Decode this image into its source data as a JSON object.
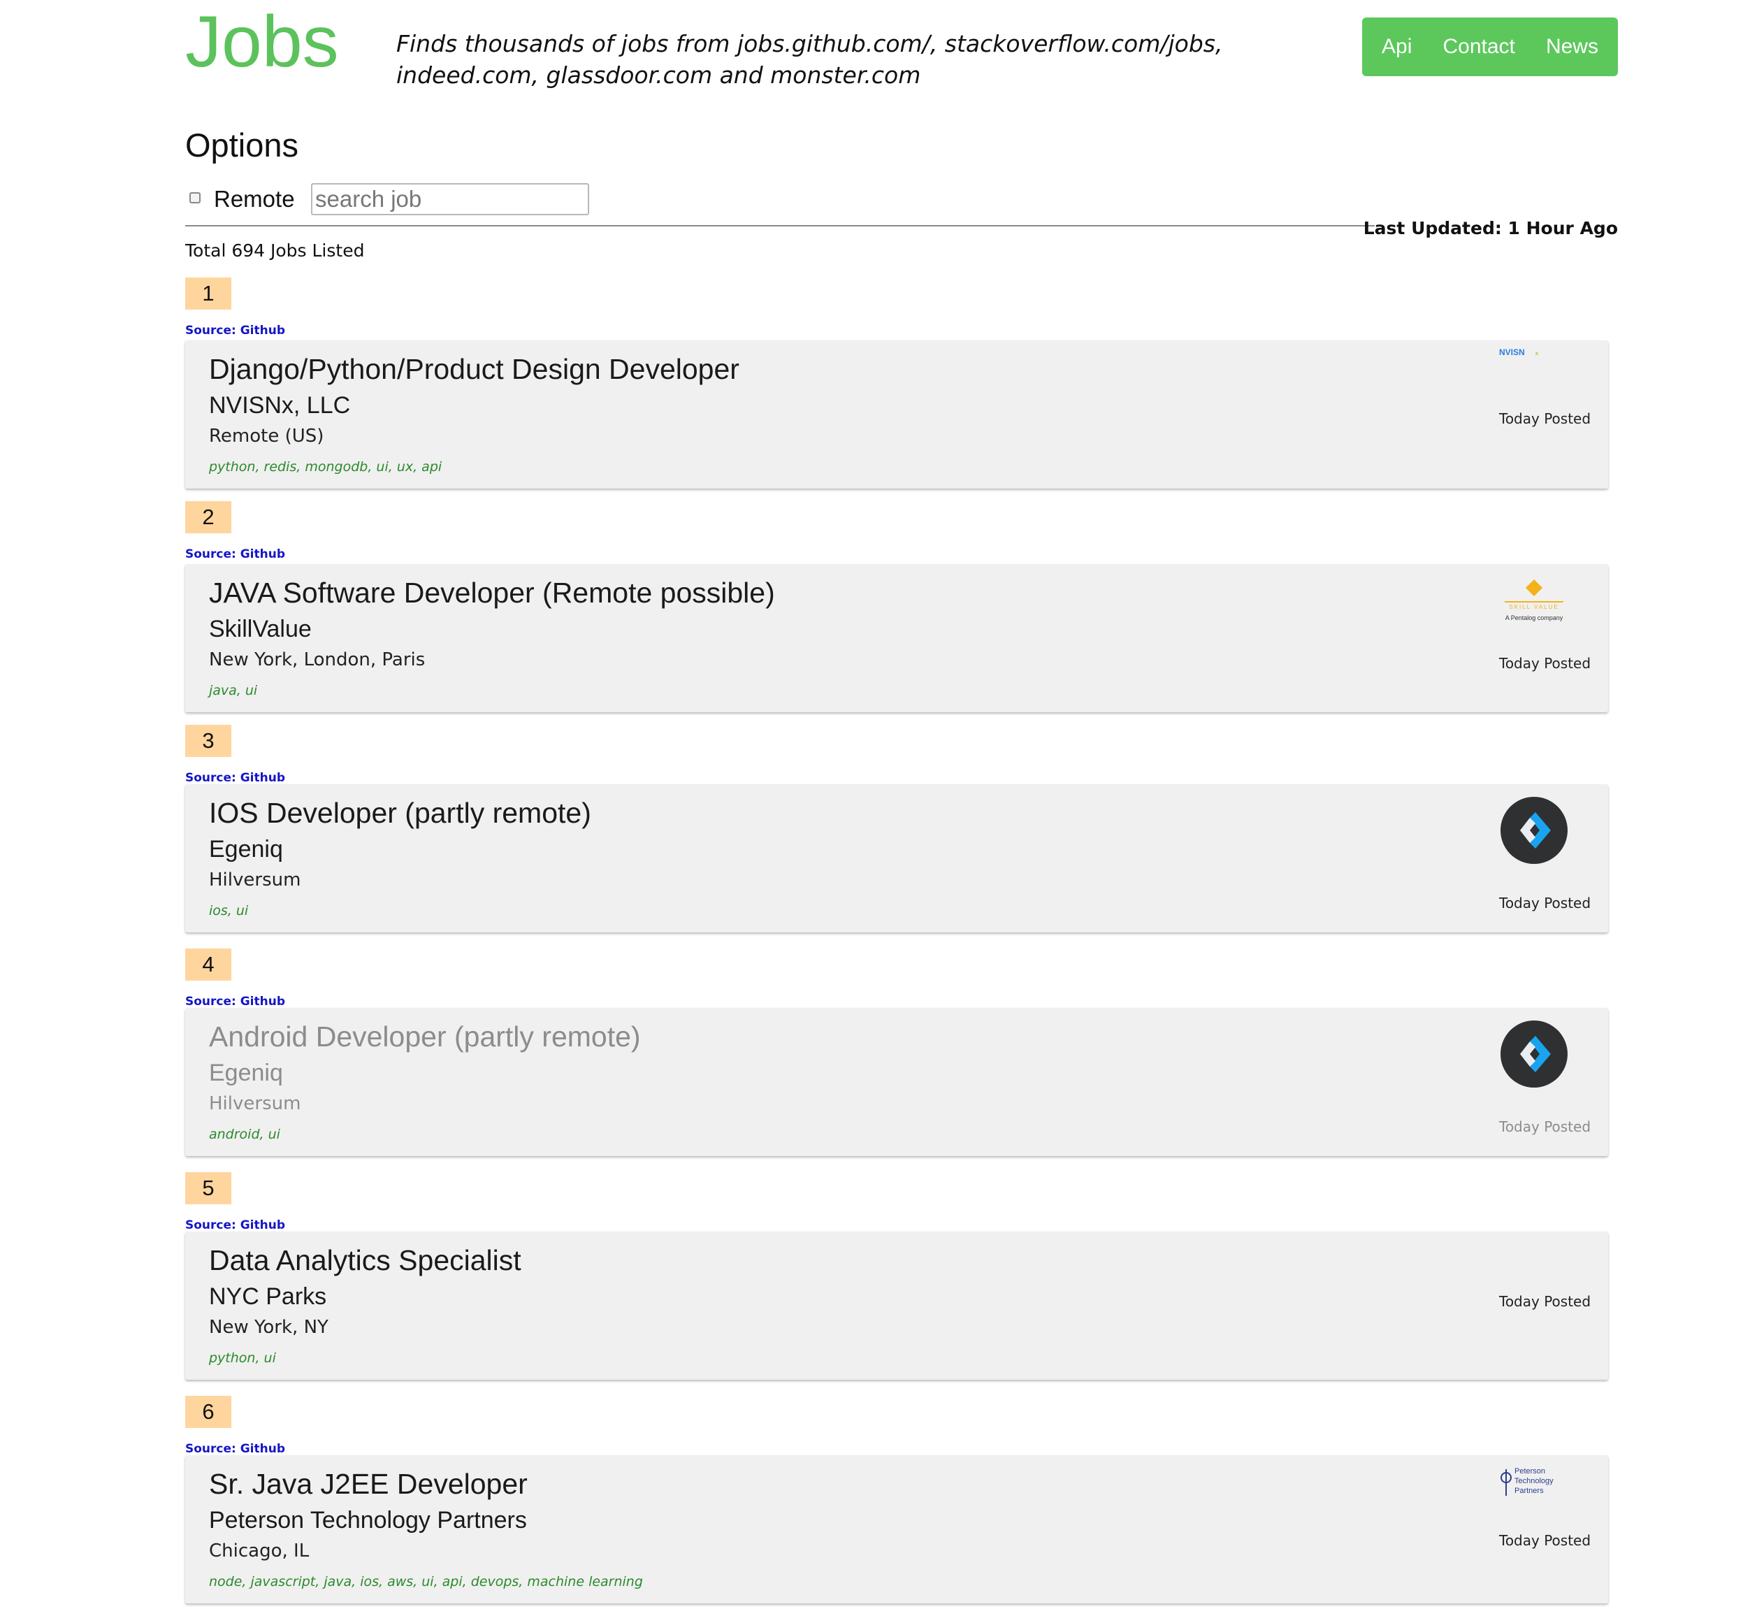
{
  "header": {
    "brand": "Jobs",
    "tagline": "Finds thousands of jobs from jobs.github.com/, stackoverflow.com/jobs, indeed.com, glassdoor.com and monster.com",
    "nav": [
      "Api",
      "Contact",
      "News"
    ],
    "accent_color": "#5cc25c"
  },
  "options": {
    "title": "Options",
    "remote_label": "Remote",
    "remote_checked": false,
    "search_placeholder": "search job",
    "search_value": "",
    "last_updated": "Last Updated: 1 Hour Ago",
    "total": "Total 694 Jobs Listed"
  },
  "jobs": [
    {
      "rank": "1",
      "source": "Source: Github",
      "title": "Django/Python/Product Design Developer",
      "company": "NVISNx, LLC",
      "location": "Remote (US)",
      "tags": "python, redis, mongodb, ui, ux, api",
      "posted": "Today Posted",
      "logo": "nvisn-logo",
      "logo_text": "NVISN"
    },
    {
      "rank": "2",
      "source": "Source: Github",
      "title": "JAVA Software Developer (Remote possible)",
      "company": "SkillValue",
      "location": "New York, London, Paris",
      "tags": "java, ui",
      "posted": "Today Posted",
      "logo": "skillvalue-logo",
      "logo_text": "SKILL VALUE",
      "logo_subtext": "A Pentalog company"
    },
    {
      "rank": "3",
      "source": "Source: Github",
      "title": "IOS Developer (partly remote)",
      "company": "Egeniq",
      "location": "Hilversum",
      "tags": "ios, ui",
      "posted": "Today Posted",
      "logo": "egeniq-logo"
    },
    {
      "rank": "4",
      "source": "Source: Github",
      "title": "Android Developer (partly remote)",
      "company": "Egeniq",
      "location": "Hilversum",
      "tags": "android, ui",
      "posted": "Today Posted",
      "logo": "egeniq-logo"
    },
    {
      "rank": "5",
      "source": "Source: Github",
      "title": "Data Analytics Specialist",
      "company": "NYC Parks",
      "location": "New York, NY",
      "tags": "python, ui",
      "posted": "Today Posted",
      "logo": ""
    },
    {
      "rank": "6",
      "source": "Source: Github",
      "title": "Sr. Java J2EE Developer",
      "company": "Peterson Technology Partners",
      "location": "Chicago, IL",
      "tags": "node, javascript, java, ios, aws, ui, api, devops, machine learning",
      "posted": "Today Posted",
      "logo": "peterson-logo",
      "logo_lines": [
        "Peterson",
        "Technology",
        "Partners"
      ]
    }
  ]
}
